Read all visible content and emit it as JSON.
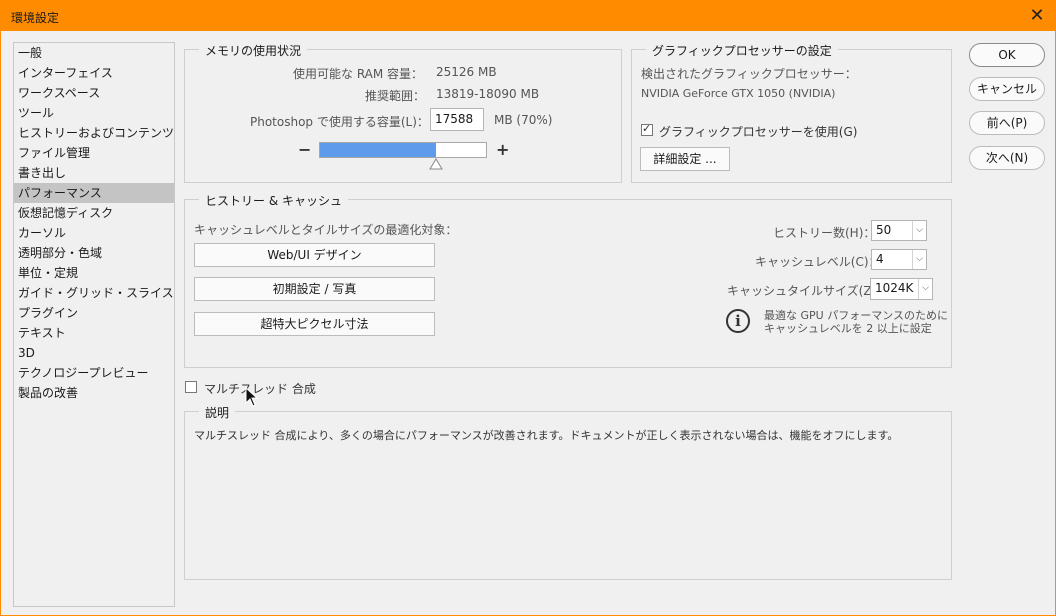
{
  "window": {
    "title": "環境設定",
    "close_glyph": "✕"
  },
  "sidebar": {
    "items": [
      "一般",
      "インターフェイス",
      "ワークスペース",
      "ツール",
      "ヒストリーおよびコンテンツ認証 ...",
      "ファイル管理",
      "書き出し",
      "パフォーマンス",
      "仮想記憶ディスク",
      "カーソル",
      "透明部分・色域",
      "単位・定規",
      "ガイド・グリッド・スライス",
      "プラグイン",
      "テキスト",
      "3D",
      "テクノロジープレビュー",
      "製品の改善"
    ],
    "active_index": 7
  },
  "memory": {
    "title": "メモリの使用状況",
    "available_label": "使用可能な RAM 容量：",
    "available_value": "25126 MB",
    "range_label": "推奨範囲：",
    "range_value": "13819-18090 MB",
    "use_label": "Photoshop で使用する容量(L)：",
    "use_value": "17588",
    "use_suffix": "MB (70%)",
    "minus": "−",
    "plus": "+",
    "slider_percent": 70
  },
  "gpu": {
    "title": "グラフィックプロセッサーの設定",
    "detected_label": "検出されたグラフィックプロセッサー：",
    "detected_value": "NVIDIA GeForce GTX 1050 (NVIDIA)",
    "use_gpu_label": "グラフィックプロセッサーを使用(G)",
    "use_gpu_checked": true,
    "advanced_button": "詳細設定 ..."
  },
  "history": {
    "title": "ヒストリー & キャッシュ",
    "optimize_label": "キャッシュレベルとタイルサイズの最適化対象：",
    "buttons": [
      "Web/UI デザイン",
      "初期設定 / 写真",
      "超特大ピクセル寸法"
    ],
    "history_states_label": "ヒストリー数(H)：",
    "history_states_value": "50",
    "cache_levels_label": "キャッシュレベル(C)：",
    "cache_levels_value": "4",
    "tile_size_label": "キャッシュタイルサイズ(Z)：",
    "tile_size_value": "1024K",
    "info_icon": "i",
    "info_line1": "最適な GPU パフォーマンスのために",
    "info_line2": "キャッシュレベルを 2 以上に設定"
  },
  "multithread": {
    "label": "マルチスレッド 合成",
    "checked": false
  },
  "description": {
    "title": "説明",
    "text": "マルチスレッド 合成により、多くの場合にパフォーマンスが改善されます。ドキュメントが正しく表示されない場合は、機能をオフにします。"
  },
  "actions": {
    "ok": "OK",
    "cancel": "キャンセル",
    "prev": "前へ(P)",
    "next": "次へ(N)"
  },
  "colors": {
    "titlebar": "#ff8c00",
    "slider_fill": "#5e9bea",
    "active_item": "#c4c4c4"
  }
}
